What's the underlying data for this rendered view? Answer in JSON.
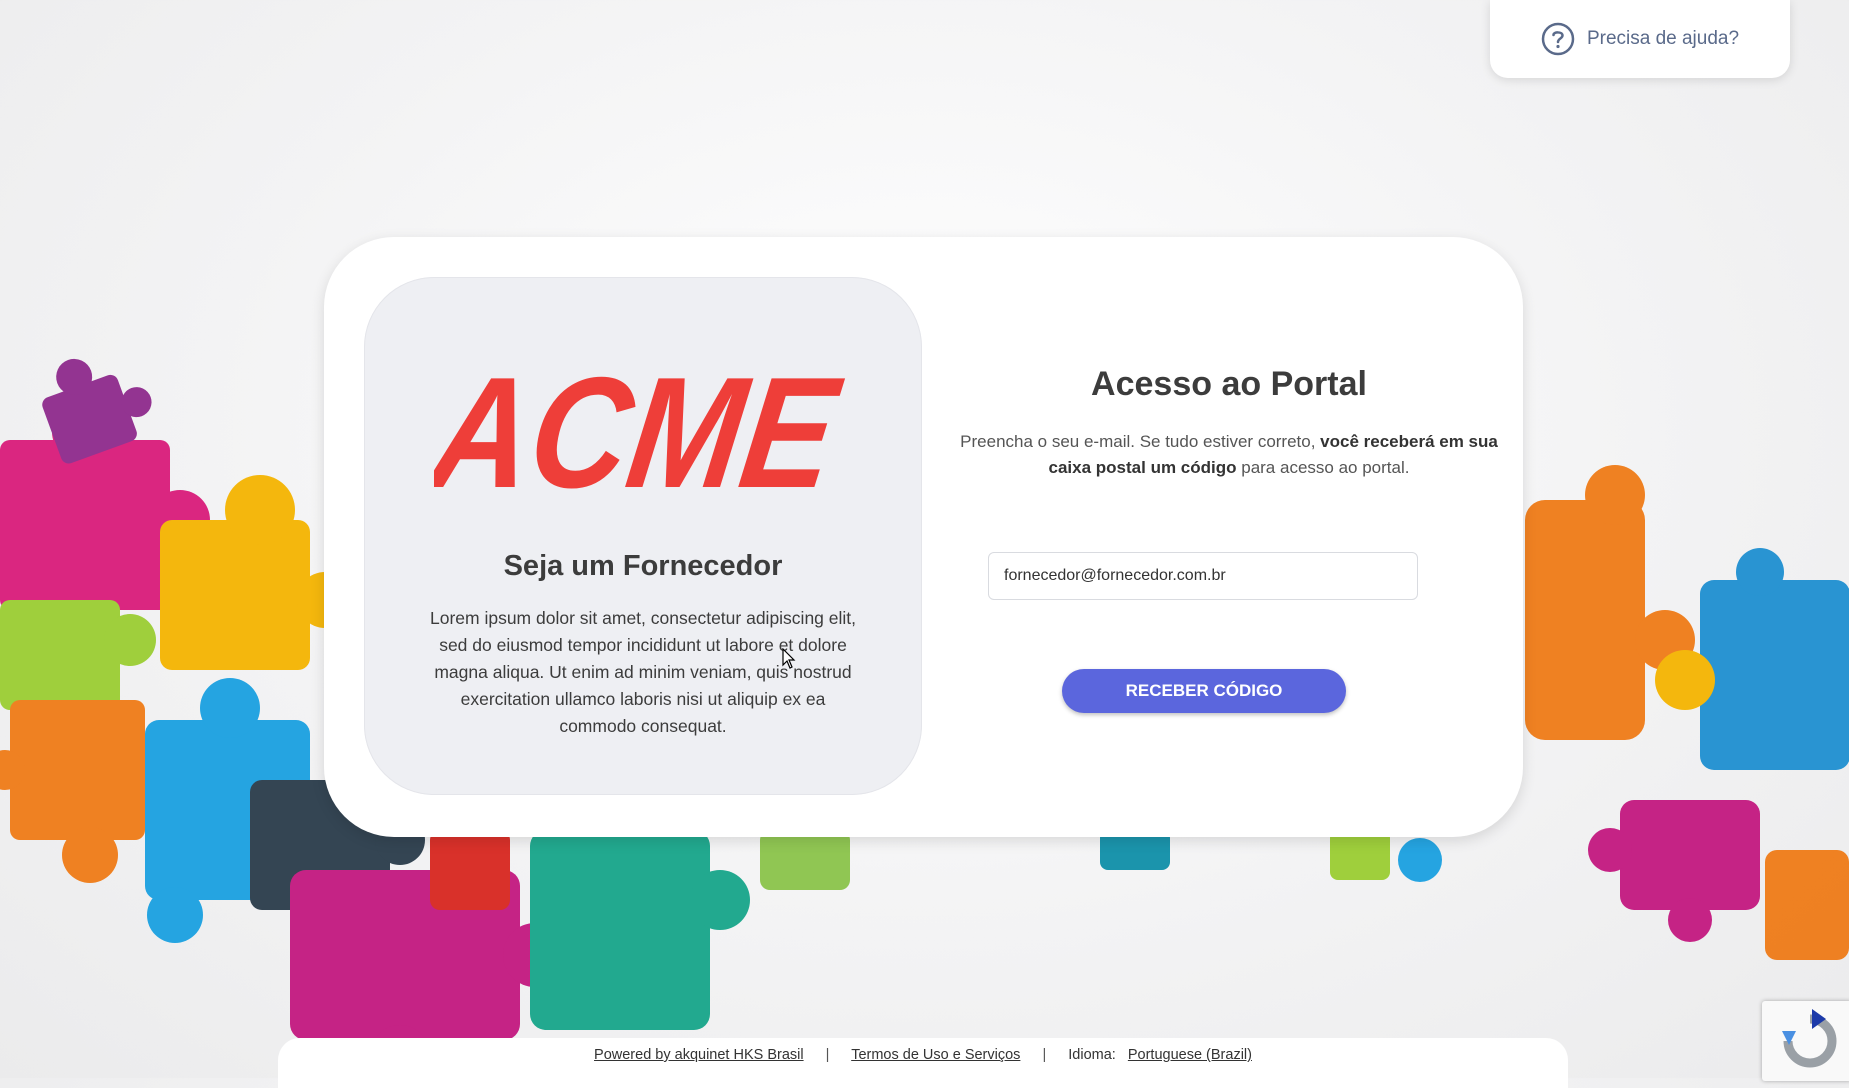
{
  "help": {
    "label": "Precisa de ajuda?"
  },
  "brand": {
    "logo_text": "ACME",
    "logo_color": "#ee3e39",
    "title": "Seja um Fornecedor",
    "description": "Lorem ipsum dolor sit amet, consectetur adipiscing elit, sed do eiusmod tempor incididunt ut labore et dolore magna aliqua. Ut enim ad minim veniam, quis nostrud exercitation ullamco laboris nisi ut aliquip ex ea commodo consequat."
  },
  "login": {
    "title": "Acesso ao Portal",
    "desc_before": "Preencha o seu e-mail. Se tudo estiver correto, ",
    "desc_bold": "você receberá em sua caixa postal um código",
    "desc_after": " para acesso ao portal.",
    "email_value": "fornecedor@fornecedor.com.br",
    "submit_label": "RECEBER CÓDIGO",
    "accent": "#5b66dd"
  },
  "footer": {
    "powered_by": "Powered by akquinet HKS Brasil",
    "separator": "|",
    "terms": "Termos de Uso e Serviços",
    "language_label": "Idioma:",
    "language_value": "Portuguese (Brazil)"
  }
}
